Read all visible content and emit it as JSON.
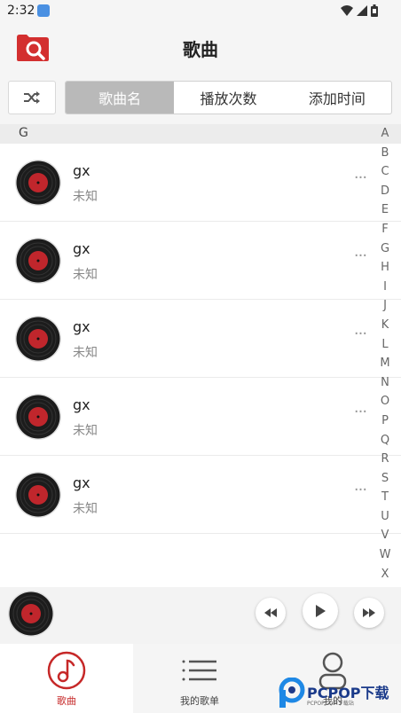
{
  "status_bar": {
    "time": "2:32"
  },
  "header": {
    "title": "歌曲"
  },
  "sort_tabs": [
    {
      "label": "歌曲名",
      "active": true
    },
    {
      "label": "播放次数",
      "active": false
    },
    {
      "label": "添加时间",
      "active": false
    }
  ],
  "section": {
    "letter": "G"
  },
  "songs": [
    {
      "title": "gx",
      "artist": "未知",
      "more": "···"
    },
    {
      "title": "gx",
      "artist": "未知",
      "more": "···"
    },
    {
      "title": "gx",
      "artist": "未知",
      "more": "···"
    },
    {
      "title": "gx",
      "artist": "未知",
      "more": "···"
    },
    {
      "title": "gx",
      "artist": "未知",
      "more": "···"
    }
  ],
  "alpha_index": [
    "A",
    "B",
    "C",
    "D",
    "E",
    "F",
    "G",
    "H",
    "I",
    "J",
    "K",
    "L",
    "M",
    "N",
    "O",
    "P",
    "Q",
    "R",
    "S",
    "T",
    "U",
    "V",
    "W",
    "X"
  ],
  "bottom_nav": [
    {
      "label": "歌曲",
      "icon": "music-note-icon",
      "active": true
    },
    {
      "label": "我的歌单",
      "icon": "list-icon",
      "active": false
    },
    {
      "label": "我的",
      "icon": "person-icon",
      "active": false
    }
  ],
  "watermark": {
    "text": "PCPOP下载",
    "sub": "PCPOP.COM下载站"
  },
  "colors": {
    "accent": "#c62828",
    "tab_active": "#b9b9b9",
    "disc_label": "#c0262c"
  }
}
